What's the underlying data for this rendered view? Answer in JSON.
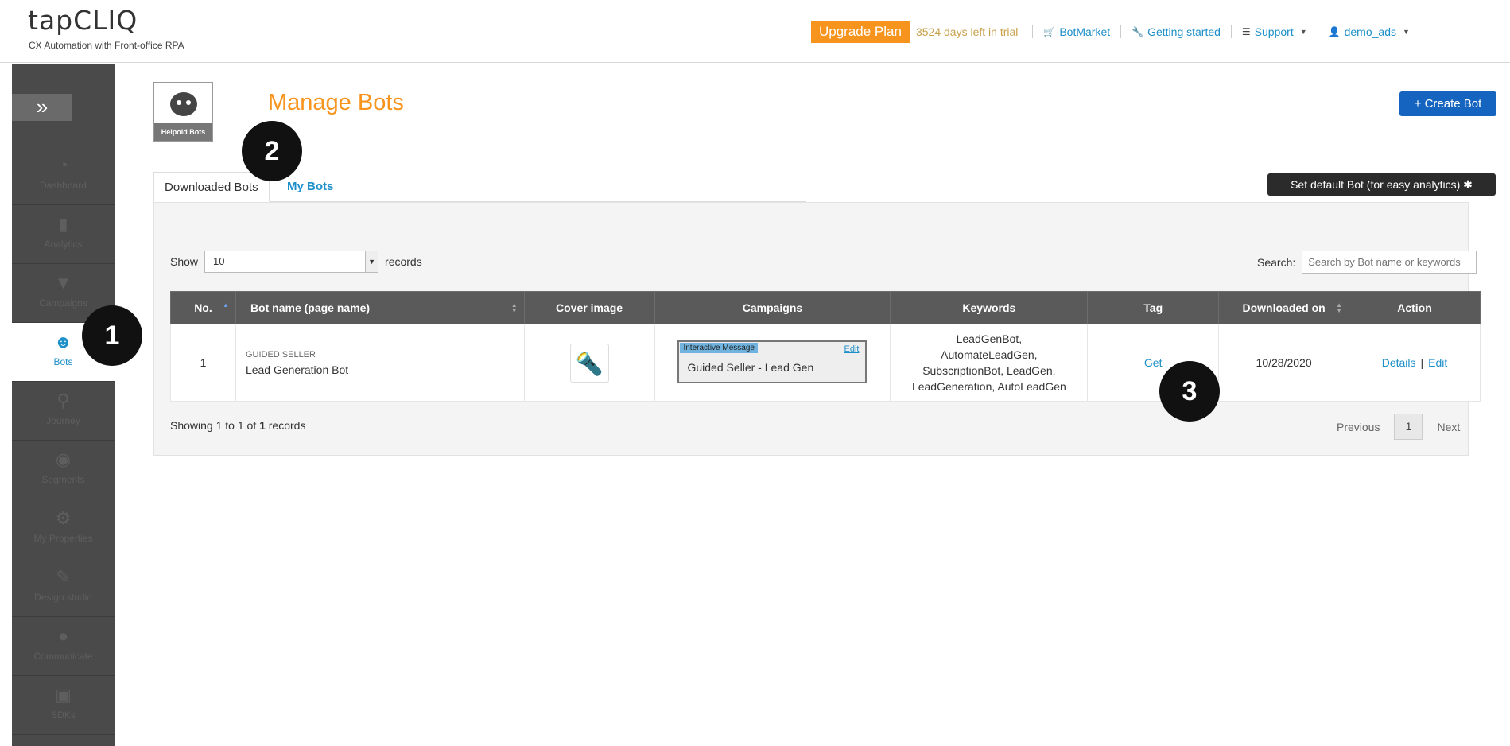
{
  "header": {
    "logo": "tapCLIQ",
    "tagline": "CX Automation with Front-office RPA",
    "upgrade_label": "Upgrade Plan",
    "trial_text": "3524 days left in trial",
    "nav": {
      "botmarket": "BotMarket",
      "getting_started": "Getting started",
      "support": "Support",
      "user": "demo_ads"
    }
  },
  "sidebar": {
    "expand_icon": "»",
    "items": [
      {
        "label": "Dashboard",
        "icon": "speedometer-icon"
      },
      {
        "label": "Analytics",
        "icon": "bar-chart-icon"
      },
      {
        "label": "Campaigns",
        "icon": "campaign-icon"
      },
      {
        "label": "Bots",
        "icon": "bot-icon"
      },
      {
        "label": "Journey",
        "icon": "journey-icon"
      },
      {
        "label": "Segments",
        "icon": "segments-icon"
      },
      {
        "label": "My Properties",
        "icon": "gear-icon"
      },
      {
        "label": "Design studio",
        "icon": "design-icon"
      },
      {
        "label": "Communicate",
        "icon": "chat-icon"
      },
      {
        "label": "SDKs",
        "icon": "sdk-icon"
      }
    ]
  },
  "main": {
    "logo_label": "Helpoid Bots",
    "title": "Manage Bots",
    "create_button": "+ Create Bot",
    "default_button": "Set default Bot (for easy analytics) ✱",
    "tabs": [
      "Downloaded Bots",
      "My Bots"
    ],
    "show_label": "Show",
    "show_value": "10",
    "records_label": "records",
    "search_label": "Search:",
    "search_placeholder": "Search by Bot name or keywords",
    "table": {
      "headers": [
        "No.",
        "Bot name (page name)",
        "Cover image",
        "Campaigns",
        "Keywords",
        "Tag",
        "Downloaded on",
        "Action"
      ],
      "rows": [
        {
          "no": "1",
          "subtitle": "GUIDED SELLER",
          "name": "Lead Generation Bot",
          "campaign_tag": "Interactive Message",
          "campaign_edit": "Edit",
          "campaign_name": "Guided Seller - Lead Gen",
          "keywords": [
            "LeadGenBot,",
            "AutomateLeadGen,",
            "SubscriptionBot, LeadGen,",
            "LeadGeneration, AutoLeadGen"
          ],
          "tag": "Get",
          "downloaded_on": "10/28/2020",
          "action_details": "Details",
          "action_sep": "|",
          "action_edit": "Edit"
        }
      ]
    },
    "showing_prefix": "Showing 1 to 1 of",
    "showing_total": "1",
    "showing_suffix": "records",
    "pager": {
      "previous": "Previous",
      "page": "1",
      "next": "Next"
    }
  },
  "markers": [
    "1",
    "2",
    "3"
  ]
}
